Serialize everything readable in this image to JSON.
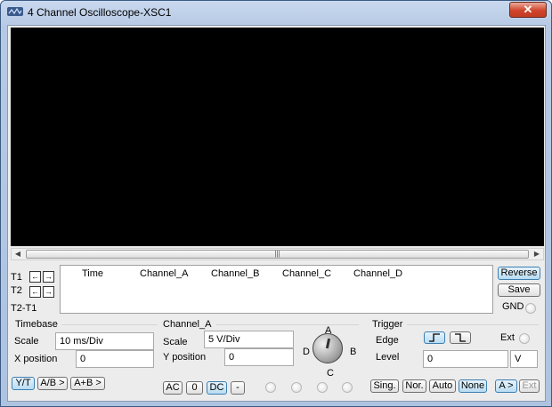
{
  "window": {
    "title": "4 Channel Oscilloscope-XSC1",
    "close_label": "✕"
  },
  "scrollbar": {
    "thumb_grip": "|||"
  },
  "cursors": {
    "t1": "T1",
    "t2": "T2",
    "t2_t1": "T2-T1"
  },
  "readout": {
    "columns": [
      "Time",
      "Channel_A",
      "Channel_B",
      "Channel_C",
      "Channel_D"
    ]
  },
  "side_buttons": {
    "reverse": "Reverse",
    "save": "Save",
    "gnd": "GND"
  },
  "timebase": {
    "title": "Timebase",
    "scale_label": "Scale",
    "scale_value": "10 ms/Div",
    "xpos_label": "X position",
    "xpos_value": "0",
    "modes": [
      "Y/T",
      "A/B >",
      "A+B >"
    ]
  },
  "channel": {
    "title": "Channel_A",
    "scale_label": "Scale",
    "scale_value": "5  V/Div",
    "ypos_label": "Y position",
    "ypos_value": "0",
    "coupling": [
      "AC",
      "0",
      "DC",
      "-"
    ],
    "knob_labels": {
      "a": "A",
      "b": "B",
      "c": "C",
      "d": "D"
    }
  },
  "trigger": {
    "title": "Trigger",
    "edge_label": "Edge",
    "ext_label": "Ext",
    "level_label": "Level",
    "level_value": "0",
    "level_unit": "V",
    "modes": [
      "Sing.",
      "Nor.",
      "Auto",
      "None"
    ],
    "source": [
      "A >",
      "Ext"
    ]
  }
}
